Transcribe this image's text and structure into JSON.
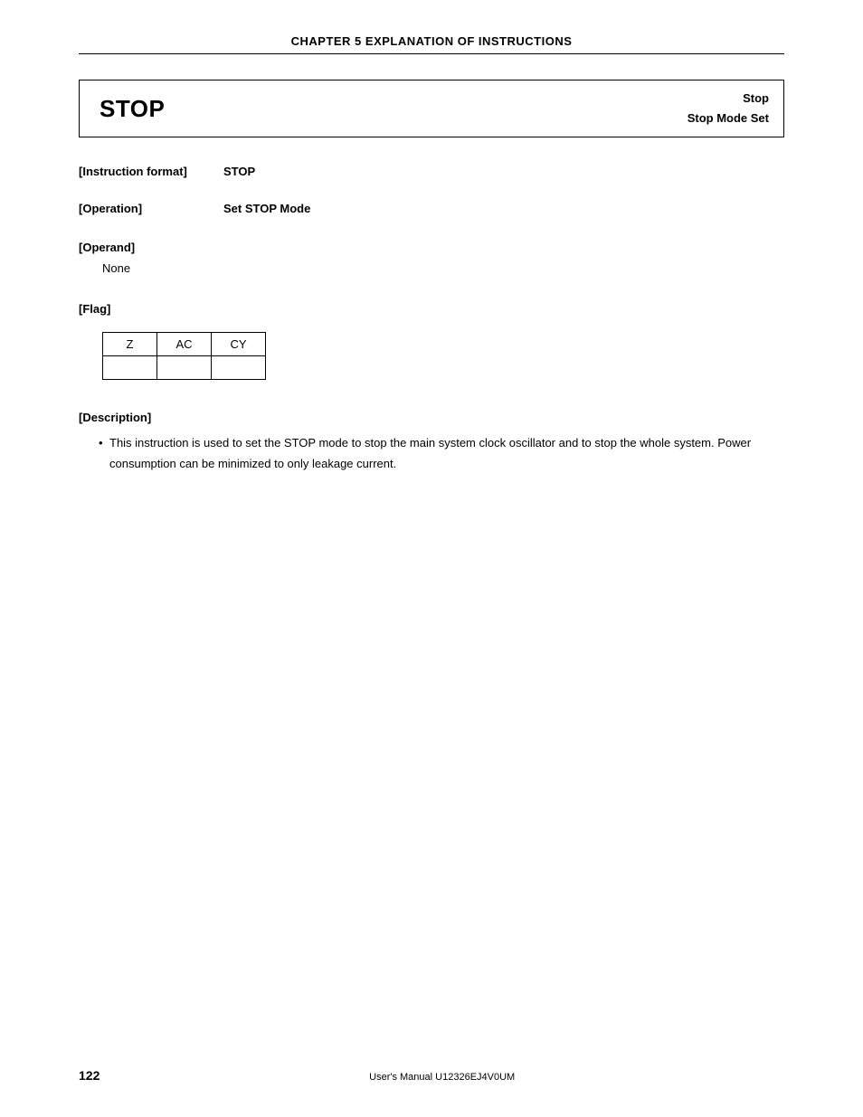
{
  "chapter_header": "CHAPTER 5  EXPLANATION OF INSTRUCTIONS",
  "instruction": {
    "name": "STOP",
    "summary_line1": "Stop",
    "summary_line2": "Stop Mode Set"
  },
  "fields": {
    "instruction_format_label": "[Instruction format]",
    "instruction_format_value": "STOP",
    "operation_label": "[Operation]",
    "operation_value": "Set STOP Mode",
    "operand_label": "[Operand]",
    "operand_value": "None",
    "flag_label": "[Flag]",
    "description_label": "[Description]"
  },
  "flag_table": {
    "headers": [
      "Z",
      "AC",
      "CY"
    ],
    "row": [
      "",
      "",
      ""
    ]
  },
  "description": {
    "bullet1": "This instruction is used to set the STOP mode to stop the main system clock oscillator and to stop the whole system.  Power consumption can be minimized to only leakage current."
  },
  "footer": {
    "page_number": "122",
    "manual": "User's Manual  U12326EJ4V0UM"
  }
}
